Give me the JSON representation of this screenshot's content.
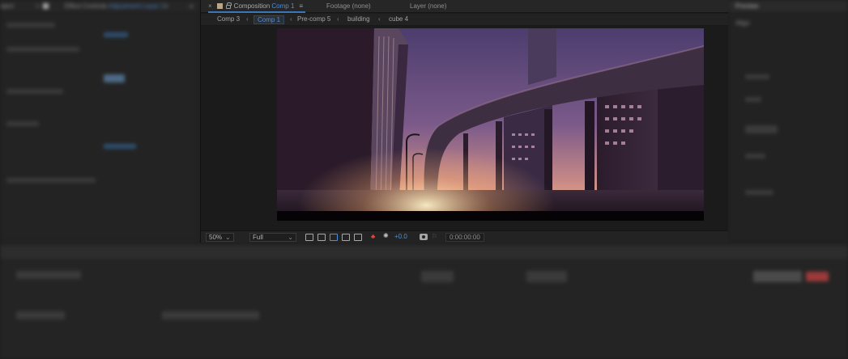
{
  "left_panel": {
    "tab_partial": "oject",
    "tab_label": "Effect Controls",
    "tab_layer": "Adjustment Layer 2",
    "menu": "≡",
    "overflow": "»"
  },
  "comp_panel": {
    "tabs": {
      "close": "×",
      "composition_label": "Composition",
      "composition_value": "Comp 1",
      "menu": "≡",
      "footage_label": "Footage",
      "footage_value": "(none)",
      "layer_label": "Layer",
      "layer_value": "(none)"
    },
    "breadcrumbs": [
      "Comp 3",
      "Comp 1",
      "Pre-comp 5",
      "building",
      "cube 4"
    ],
    "active_breadcrumb": "Comp 1",
    "footer": {
      "zoom": "50%",
      "resolution": "Full",
      "exposure": "+0.0",
      "timecode": "0:00:00:00"
    }
  },
  "right_panel": {
    "title": "Preview",
    "subtitle": "Align"
  },
  "colors": {
    "accent_blue": "#4e8fda",
    "panel_bg": "#232323",
    "comp_bg": "#1b1b1b"
  }
}
